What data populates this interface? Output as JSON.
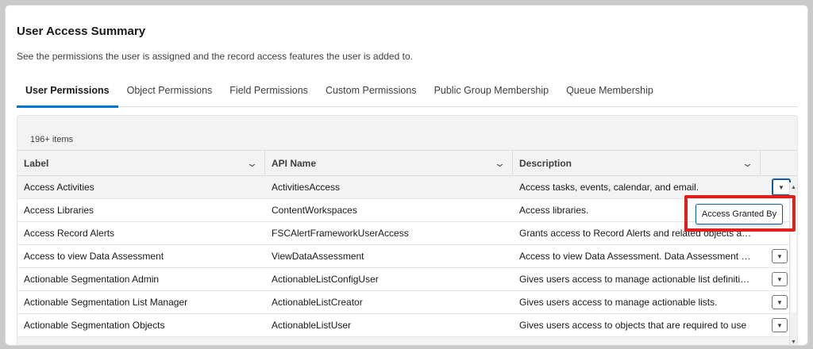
{
  "card": {
    "title": "User Access Summary",
    "description": "See the permissions the user is assigned and the record access features the user is added to."
  },
  "tabs": [
    {
      "label": "User Permissions",
      "active": true
    },
    {
      "label": "Object Permissions"
    },
    {
      "label": "Field Permissions"
    },
    {
      "label": "Custom Permissions"
    },
    {
      "label": "Public Group Membership"
    },
    {
      "label": "Queue Membership"
    }
  ],
  "table": {
    "item_count": "196+ items",
    "columns": [
      "Label",
      "API Name",
      "Description"
    ],
    "rows": [
      {
        "label": "Access Activities",
        "api": "ActivitiesAccess",
        "description": "Access tasks, events, calendar, and email."
      },
      {
        "label": "Access Libraries",
        "api": "ContentWorkspaces",
        "description": "Access libraries."
      },
      {
        "label": "Access Record Alerts",
        "api": "FSCAlertFrameworkUserAccess",
        "description": "Grants access to Record Alerts and related objects and fields"
      },
      {
        "label": "Access to view Data Assessment",
        "api": "ViewDataAssessment",
        "description": "Access to view Data Assessment. Data Assessment provides"
      },
      {
        "label": "Actionable Segmentation Admin",
        "api": "ActionableListConfigUser",
        "description": "Gives users access to manage actionable list definitions"
      },
      {
        "label": "Actionable Segmentation List Manager",
        "api": "ActionableListCreator",
        "description": "Gives users access to manage actionable lists."
      },
      {
        "label": "Actionable Segmentation Objects",
        "api": "ActionableListUser",
        "description": "Gives users access to objects that are required to use"
      }
    ]
  },
  "row_menu": {
    "item": "Access Granted By"
  },
  "icons": {
    "column_chevron": "chevron-down-icon",
    "row_action": "caret-down-icon"
  },
  "colors": {
    "accent": "#0176d3",
    "highlight": "#e0201b"
  }
}
